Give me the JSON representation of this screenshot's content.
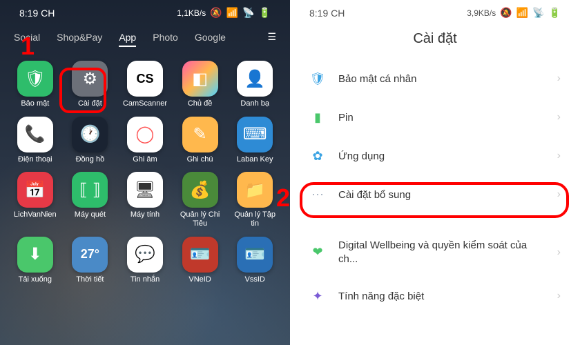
{
  "left": {
    "status": {
      "time": "8:19 CH",
      "rate": "1,1KB/s"
    },
    "tabs": [
      "Social",
      "Shop&Pay",
      "App",
      "Photo",
      "Google"
    ],
    "active_tab": 2,
    "apps": [
      {
        "label": "Bảo mật",
        "bg": "#2ebd6b",
        "glyph": "🛡"
      },
      {
        "label": "Cài đặt",
        "bg": "#6c7079",
        "glyph": "⚙"
      },
      {
        "label": "CamScanner",
        "bg": "#ffffff",
        "glyph": "CS",
        "fg": "#000"
      },
      {
        "label": "Chủ đề",
        "bg": "linear-gradient(135deg,#ff5fa2,#ffb84d,#4dd2ff)",
        "glyph": "◧"
      },
      {
        "label": "Danh bạ",
        "bg": "#ffffff",
        "glyph": "👤",
        "fg": "#4a6"
      },
      {
        "label": "Điện thoại",
        "bg": "#ffffff",
        "glyph": "📞",
        "fg": "#3a7bd5"
      },
      {
        "label": "Đồng hồ",
        "bg": "#1a2332",
        "glyph": "🕐"
      },
      {
        "label": "Ghi âm",
        "bg": "#ffffff",
        "glyph": "◯",
        "fg": "#f55"
      },
      {
        "label": "Ghi chú",
        "bg": "#ffb84d",
        "glyph": "✎"
      },
      {
        "label": "Laban Key",
        "bg": "#2e8bd5",
        "glyph": "⌨"
      },
      {
        "label": "LichVanNien",
        "bg": "#e63946",
        "glyph": "📅"
      },
      {
        "label": "Máy quét",
        "bg": "#2ebd6b",
        "glyph": "⟦ ⟧"
      },
      {
        "label": "Máy tính",
        "bg": "#ffffff",
        "glyph": "🖥",
        "fg": "#333"
      },
      {
        "label": "Quản lý Chi Tiêu",
        "bg": "#4a8a3a",
        "glyph": "💰"
      },
      {
        "label": "Quản lý Tập tin",
        "bg": "#ffb84d",
        "glyph": "📁"
      },
      {
        "label": "Tải xuống",
        "bg": "#4ac76b",
        "glyph": "⬇"
      },
      {
        "label": "Thời tiết",
        "bg": "#4a8ac7",
        "glyph": "27°",
        "fg": "#fff"
      },
      {
        "label": "Tin nhắn",
        "bg": "#ffffff",
        "glyph": "💬",
        "fg": "#3a7bd5"
      },
      {
        "label": "VNeID",
        "bg": "#c0392b",
        "glyph": "🪪"
      },
      {
        "label": "VssID",
        "bg": "#2a6fb5",
        "glyph": "🪪"
      }
    ]
  },
  "right": {
    "status": {
      "time": "8:19 CH",
      "rate": "3,9KB/s"
    },
    "title": "Cài đặt",
    "rows": [
      {
        "label": "Bảo mật cá nhân",
        "iconColor": "#3aa3e3",
        "glyph": "🛡"
      },
      {
        "label": "Pin",
        "iconColor": "#4ac76b",
        "glyph": "▮"
      },
      {
        "label": "Ứng dụng",
        "iconColor": "#3aa3e3",
        "glyph": "✿"
      },
      {
        "label": "Cài đặt bổ sung",
        "iconColor": "#a8b4c3",
        "glyph": "⋯"
      },
      {
        "label": "Digital Wellbeing và quyền kiểm soát của ch...",
        "iconColor": "#4ac76b",
        "glyph": "❤"
      },
      {
        "label": "Tính năng đặc biệt",
        "iconColor": "#7a5bd5",
        "glyph": "✦"
      }
    ]
  },
  "annot": {
    "one": "1",
    "two": "2"
  }
}
